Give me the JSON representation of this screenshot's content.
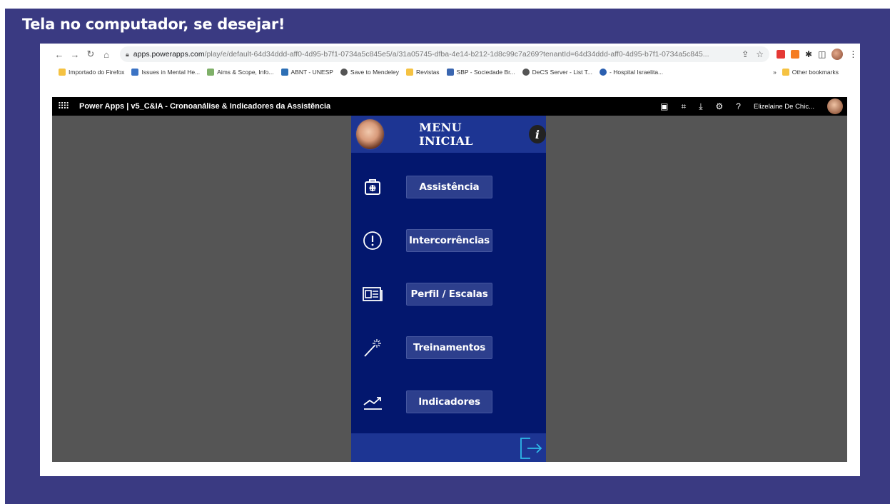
{
  "slide": {
    "title": "Tela no computador, se desejar!"
  },
  "browser": {
    "url_host": "apps.powerapps.com",
    "url_rest": "/play/e/default-64d34ddd-aff0-4d95-b7f1-0734a5c845e5/a/31a05745-dfba-4e14-b212-1d8c99c7a269?tenantId=64d34ddd-aff0-4d95-b7f1-0734a5c845...",
    "bookmarks": [
      {
        "label": "Importado do Firefox",
        "color": "#f5c242"
      },
      {
        "label": "Issues in Mental He...",
        "color": "#3b73c4"
      },
      {
        "label": "Aims & Scope, Info...",
        "color": "#7fb069"
      },
      {
        "label": "ABNT - UNESP",
        "color": "#2d6fb5"
      },
      {
        "label": "Save to Mendeley",
        "color": "#555555"
      },
      {
        "label": "Revistas",
        "color": "#f5c242"
      },
      {
        "label": "SBP - Sociedade Br...",
        "color": "#3a66b0"
      },
      {
        "label": "DeCS Server - List T...",
        "color": "#555555"
      },
      {
        "label": "- Hospital Israelita...",
        "color": "#2b5fb0"
      }
    ],
    "more_label": "»",
    "other_bookmarks": "Other bookmarks"
  },
  "powerapps": {
    "title": "Power Apps  |  v5_C&IA - Cronoanálise & Indicadores da Assistência",
    "user": "Elizelaine De Chic..."
  },
  "app": {
    "header_title": "MENU INICIAL",
    "info_glyph": "i",
    "menu": [
      {
        "label": "Assistência",
        "icon": "medical-kit-icon"
      },
      {
        "label": "Intercorrências",
        "icon": "alert-circle-icon"
      },
      {
        "label": "Perfil / Escalas",
        "icon": "newspaper-icon"
      },
      {
        "label": "Treinamentos",
        "icon": "magic-wand-icon"
      },
      {
        "label": "Indicadores",
        "icon": "trend-chart-icon"
      }
    ],
    "colors": {
      "background": "#03176e",
      "header": "#1d3593",
      "button": "#2d3f8d"
    }
  }
}
